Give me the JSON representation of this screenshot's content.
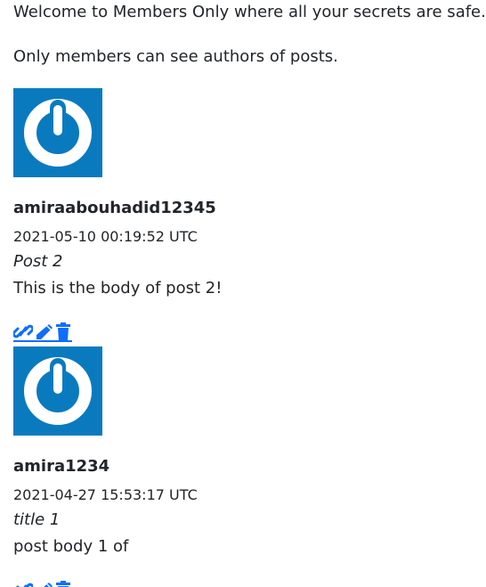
{
  "intro": {
    "welcome": "Welcome to Members Only where all your secrets are safe.",
    "note": "Only members can see authors of posts."
  },
  "posts": [
    {
      "author": "amiraabouhadid12345",
      "timestamp": "2021-05-10 00:19:52 UTC",
      "title": "Post 2",
      "body": "This is the body of post 2!"
    },
    {
      "author": "amira1234",
      "timestamp": "2021-04-27 15:53:17 UTC",
      "title": "title 1",
      "body": "post body 1 of"
    }
  ],
  "icons": {
    "avatar": "power-icon",
    "link": "link-icon",
    "edit": "pencil-icon",
    "delete": "trash-icon"
  },
  "colors": {
    "avatar_bg": "#0a7abf",
    "action": "#0d6efd",
    "text": "#212529"
  }
}
